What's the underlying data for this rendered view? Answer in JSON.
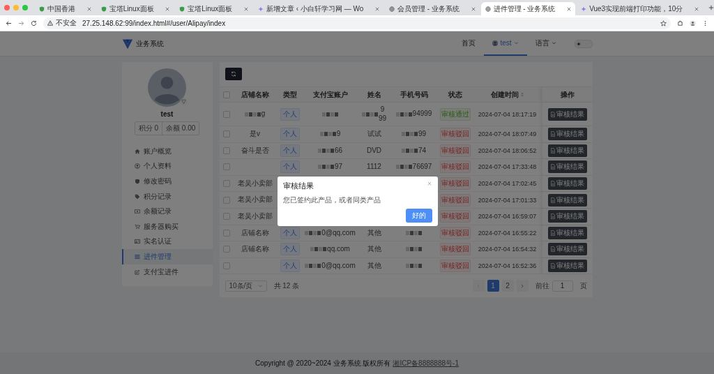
{
  "browser": {
    "tabs": [
      {
        "title": "中国香港",
        "selected": false
      },
      {
        "title": "宝塔Linux面板",
        "selected": false
      },
      {
        "title": "宝塔Linux面板",
        "selected": false
      },
      {
        "title": "新增文章 ‹ 小白轩学习网 — Wo",
        "selected": false
      },
      {
        "title": "会员管理 - 业务系统",
        "selected": false
      },
      {
        "title": "进件管理 - 业务系统",
        "selected": true
      },
      {
        "title": "Vue3实现前端打印功能，10分",
        "selected": false
      }
    ],
    "security": "不安全",
    "url": "27.25.148.62:99/index.html#/user/Alipay/index"
  },
  "header": {
    "brand": "业务系统",
    "nav": [
      {
        "label": "首页",
        "selected": false,
        "kind": "link"
      },
      {
        "label": "test",
        "selected": true,
        "kind": "user"
      },
      {
        "label": "语言",
        "selected": false,
        "kind": "menu"
      }
    ],
    "theme_toggle": {
      "on": false
    }
  },
  "profile": {
    "name": "test",
    "stats": [
      "积分 0",
      "余额 0.00"
    ]
  },
  "sidebar": {
    "items": [
      {
        "label": "账户概览",
        "selected": false
      },
      {
        "label": "个人资料",
        "selected": false
      },
      {
        "label": "修改密码",
        "selected": false
      },
      {
        "label": "积分记录",
        "selected": false
      },
      {
        "label": "余额记录",
        "selected": false
      },
      {
        "label": "服务器购买",
        "selected": false
      },
      {
        "label": "实名认证",
        "selected": false
      },
      {
        "label": "进件管理",
        "selected": true
      },
      {
        "label": "支付宝进件",
        "selected": false
      }
    ]
  },
  "table": {
    "select_all_checked": false,
    "columns": [
      "店铺名称",
      "类型",
      "支付宝账户",
      "姓名",
      "手机号码",
      "状态",
      "创建时间",
      "操作"
    ],
    "rows": [
      {
        "checked": false,
        "shop": "g",
        "type": "个人",
        "name": "9\n99",
        "phone": "94999",
        "status": "审核通过",
        "approved": true,
        "time": "2024-07-04 18:17:19",
        "action": "审核结果",
        "masked_shop": true,
        "masked_account": true,
        "masked_name": true,
        "masked_phone": true
      },
      {
        "checked": false,
        "shop": "是v",
        "type": "个人",
        "account": "9",
        "name": "试试",
        "phone": "99",
        "status": "审核驳回",
        "approved": false,
        "time": "2024-07-04 18:07:49",
        "action": "审核结果",
        "masked_account": true,
        "masked_phone": true
      },
      {
        "checked": false,
        "shop": "奋斗是否",
        "type": "个人",
        "account": "66",
        "name": "DVD",
        "phone": "74",
        "status": "审核驳回",
        "approved": false,
        "time": "2024-07-04 18:06:52",
        "action": "审核结果",
        "masked_account": true,
        "masked_phone": true
      },
      {
        "checked": false,
        "type": "个人",
        "account": "97",
        "name": "1112",
        "phone": "76697",
        "status": "审核驳回",
        "approved": false,
        "time": "2024-07-04 17:33:48",
        "action": "审核结果",
        "masked_account": true,
        "masked_phone": true
      },
      {
        "checked": false,
        "shop": "老吴小卖部",
        "status": "审核驳回",
        "approved": false,
        "time": "2024-07-04 17:02:45",
        "action": "审核结果"
      },
      {
        "checked": false,
        "shop": "老吴小卖部",
        "status": "审核驳回",
        "approved": false,
        "time": "2024-07-04 17:01:33",
        "action": "审核结果"
      },
      {
        "checked": false,
        "shop": "老吴小卖部",
        "status": "审核驳回",
        "approved": false,
        "time": "2024-07-04 16:59:07",
        "action": "审核结果"
      },
      {
        "checked": false,
        "shop": "店铺名称",
        "type": "个人",
        "account": "0@qq.com",
        "name": "其他",
        "status": "审核驳回",
        "approved": false,
        "time": "2024-07-04 16:55:22",
        "action": "审核结果",
        "masked_account": true,
        "masked_phone": true
      },
      {
        "checked": false,
        "shop": "店铺名称",
        "type": "个人",
        "account": "qq.com",
        "name": "其他",
        "status": "审核驳回",
        "approved": false,
        "time": "2024-07-04 16:54:32",
        "action": "审核结果",
        "masked_account": true,
        "masked_phone": true
      },
      {
        "checked": false,
        "type": "个人",
        "account": "0@qq.com",
        "name": "其他",
        "status": "审核驳回",
        "approved": false,
        "time": "2024-07-04 16:52:36",
        "action": "审核结果",
        "masked_account": true,
        "masked_phone": true
      }
    ]
  },
  "pagination": {
    "page_size": "10条/页",
    "total": "共 12 条",
    "prev": {
      "disabled": true
    },
    "next": {
      "disabled": false
    },
    "pages": [
      {
        "label": "1",
        "selected": true
      },
      {
        "label": "2",
        "selected": false
      }
    ],
    "goto_label": "前往",
    "goto_value": "1",
    "page_suffix": "页"
  },
  "dialog": {
    "title": "审核结果",
    "message": "您已签约此产品，或者同类产品",
    "button": "好的"
  },
  "footer": {
    "copyright": "Copyright @ 2020~2024 业务系统 版权所有",
    "icp_link": "湘ICP备8888888号-1"
  }
}
